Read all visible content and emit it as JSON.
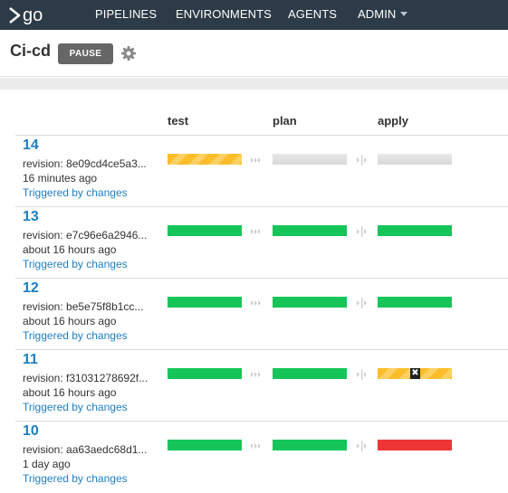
{
  "nav": {
    "logo_text": "go",
    "items": [
      {
        "label": "PIPELINES"
      },
      {
        "label": "ENVIRONMENTS"
      },
      {
        "label": "AGENTS"
      },
      {
        "label": "ADMIN"
      }
    ]
  },
  "header": {
    "pipeline_name": "Ci-cd",
    "pause_label": "PAUSE"
  },
  "stages": [
    "test",
    "plan",
    "apply"
  ],
  "colors": {
    "nav_bg": "#2d3a47",
    "passed": "#16c55a",
    "failed": "#ee3636",
    "building": "#fbbd29",
    "link": "#1f7fc1"
  },
  "rows": [
    {
      "counter": "14",
      "revision": "revision: 8e09cd4ce5a3...",
      "time": "16 minutes ago",
      "trigger": "Triggered by changes",
      "stage_status": [
        "building",
        "unknown",
        "unknown"
      ]
    },
    {
      "counter": "13",
      "revision": "revision: e7c96e6a2946...",
      "time": "about 16 hours ago",
      "trigger": "Triggered by changes",
      "stage_status": [
        "passed",
        "passed",
        "passed"
      ]
    },
    {
      "counter": "12",
      "revision": "revision: be5e75f8b1cc...",
      "time": "about 16 hours ago",
      "trigger": "Triggered by changes",
      "stage_status": [
        "passed",
        "passed",
        "passed"
      ]
    },
    {
      "counter": "11",
      "revision": "revision: f31031278692f...",
      "time": "about 16 hours ago",
      "trigger": "Triggered by changes",
      "stage_status": [
        "passed",
        "passed",
        "cancelled"
      ]
    },
    {
      "counter": "10",
      "revision": "revision: aa63aedc68d1...",
      "time": "1 day ago",
      "trigger": "Triggered by changes",
      "stage_status": [
        "passed",
        "passed",
        "failed"
      ]
    }
  ]
}
